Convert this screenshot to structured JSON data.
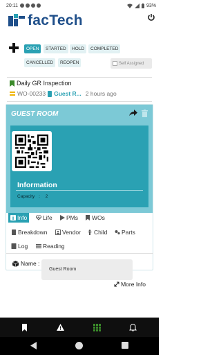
{
  "status_bar": {
    "time": "20:11",
    "battery": "93%"
  },
  "app": {
    "logo_text": "facTech"
  },
  "filters": {
    "row1": [
      "OPEN",
      "STARTED",
      "HOLD",
      "COMPLETED"
    ],
    "row2": [
      "CANCELLED",
      "REOPEN"
    ],
    "active": "OPEN",
    "self_assigned_label": "Self Assigned"
  },
  "work_order": {
    "title": "Daily GR Inspection",
    "id": "WO-00233",
    "location": "Guest R...",
    "age": "2 hours ago"
  },
  "asset": {
    "title": "GUEST ROOM",
    "info_heading": "Information",
    "capacity_label": "Capacity",
    "capacity_sep": ":",
    "capacity_value": "2"
  },
  "tabs": [
    {
      "label": "Info",
      "icon": "info-icon",
      "active": true
    },
    {
      "label": "Life",
      "icon": "heartbeat-icon"
    },
    {
      "label": "PMs",
      "icon": "play-icon"
    },
    {
      "label": "WOs",
      "icon": "bookmark-icon"
    },
    {
      "label": "Breakdown",
      "icon": "book-icon"
    },
    {
      "label": "Vendor",
      "icon": "vendor-icon"
    },
    {
      "label": "Child",
      "icon": "child-icon"
    },
    {
      "label": "Parts",
      "icon": "parts-icon"
    },
    {
      "label": "Log",
      "icon": "log-icon"
    },
    {
      "label": "Reading",
      "icon": "list-icon"
    }
  ],
  "details": {
    "name_label": "Name :",
    "name_value": "Guest Room",
    "more_info": "More Info"
  },
  "colors": {
    "accent": "#2aa1b3",
    "header_light": "#7cc9d6",
    "brand_blue": "#1f4f8a",
    "chip_bg": "#e2f1f3"
  }
}
